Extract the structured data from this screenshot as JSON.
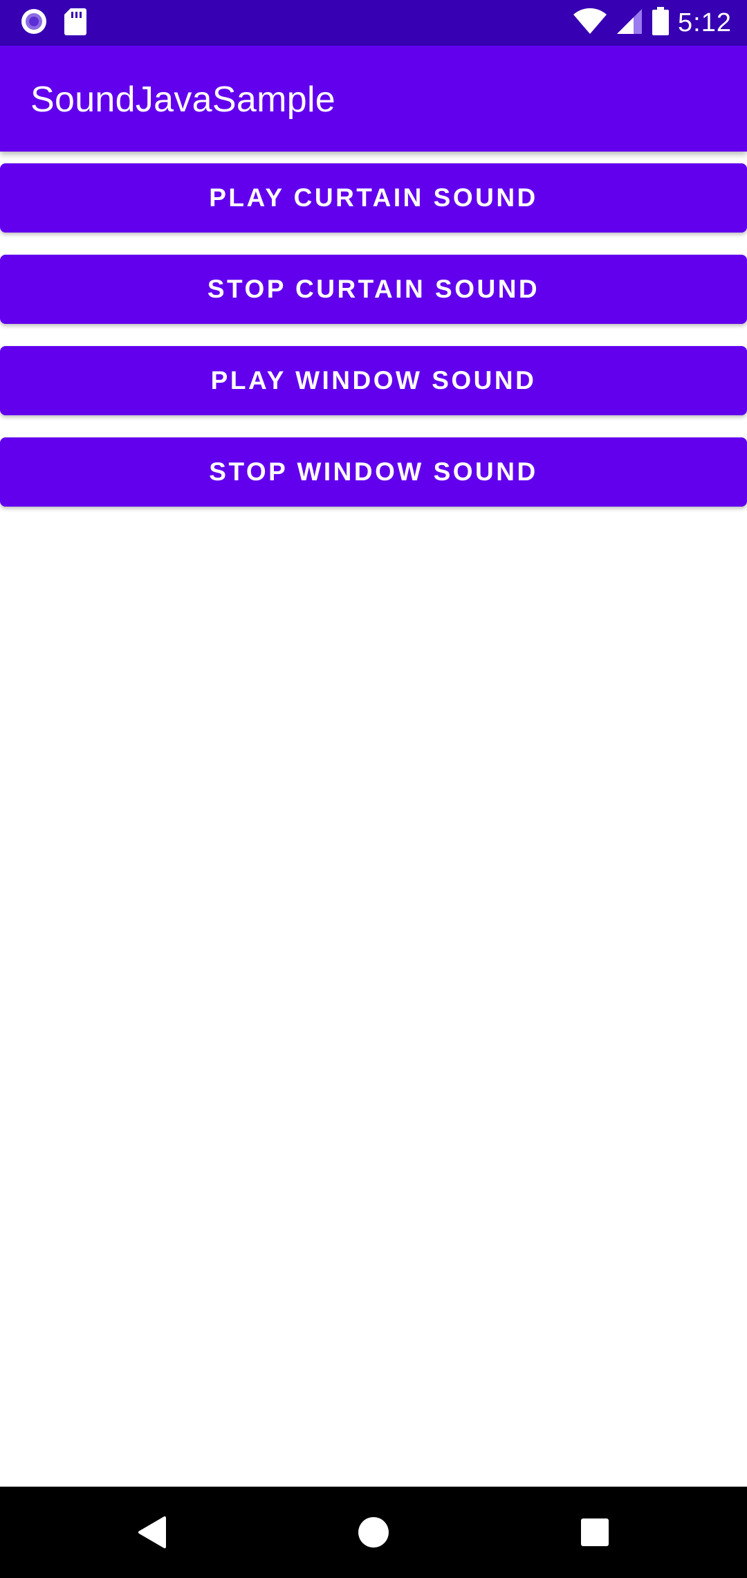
{
  "status_bar": {
    "time": "5:12",
    "left_icons": [
      "record-icon",
      "sd-card-icon"
    ],
    "right_icons": [
      "wifi-icon",
      "cell-signal-icon",
      "battery-icon"
    ]
  },
  "app_bar": {
    "title": "SoundJavaSample"
  },
  "buttons": [
    {
      "label": "PLAY CURTAIN SOUND"
    },
    {
      "label": "STOP CURTAIN SOUND"
    },
    {
      "label": "PLAY WINDOW SOUND"
    },
    {
      "label": "STOP WINDOW SOUND"
    }
  ],
  "nav_bar": {
    "icons": [
      "back-icon",
      "home-icon",
      "recents-icon"
    ]
  },
  "colors": {
    "status_bar": "#3700B3",
    "primary": "#6200EE",
    "on_primary": "#FFFFFF",
    "background": "#FFFFFF",
    "nav_bar": "#000000"
  }
}
